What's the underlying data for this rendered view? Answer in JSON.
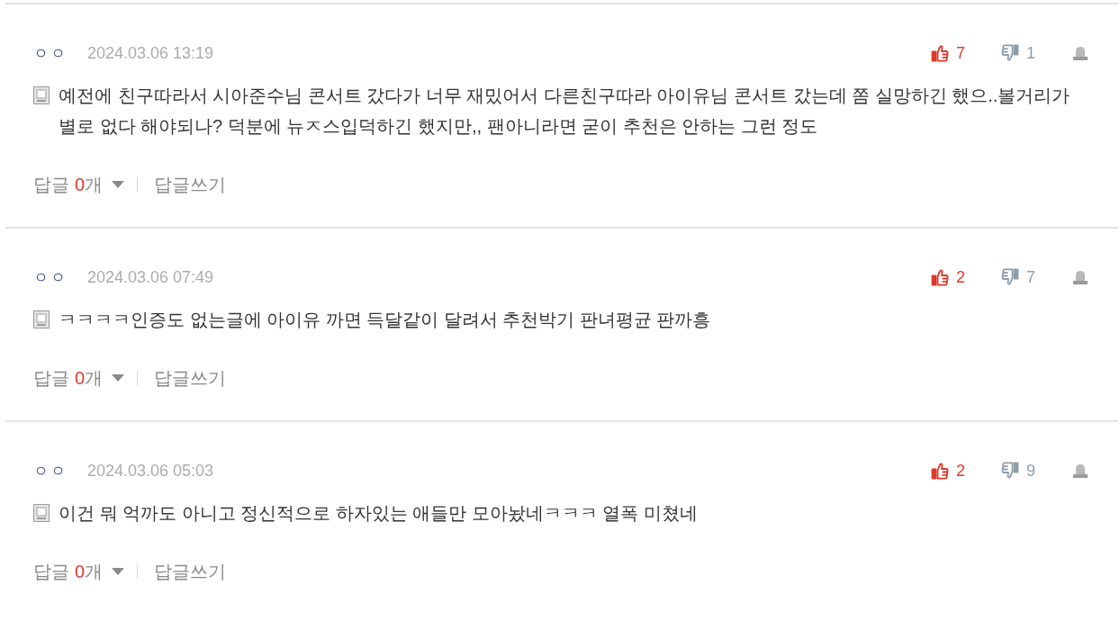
{
  "comments": [
    {
      "author": "ㅇㅇ",
      "date": "2024.03.06 13:19",
      "likes": "7",
      "dislikes": "1",
      "text": "예전에 친구따라서 시아준수님 콘서트 갔다가 너무 재밌어서 다른친구따라 아이유님 콘서트 갔는데 쫌 실망하긴 했으..볼거리가 별로 없다 해야되나? 덕분에 뉴ㅈ스입덕하긴 했지만,, 팬아니라면 굳이 추천은 안하는 그런 정도",
      "reply_label": "답글",
      "reply_count": "0",
      "reply_unit": "개",
      "write_reply": "답글쓰기"
    },
    {
      "author": "ㅇㅇ",
      "date": "2024.03.06 07:49",
      "likes": "2",
      "dislikes": "7",
      "text": "ㅋㅋㅋㅋ인증도 없는글에 아이유 까면 득달같이 달려서 추천박기 판녀평균 판까흥",
      "reply_label": "답글",
      "reply_count": "0",
      "reply_unit": "개",
      "write_reply": "답글쓰기"
    },
    {
      "author": "ㅇㅇ",
      "date": "2024.03.06 05:03",
      "likes": "2",
      "dislikes": "9",
      "text": "이건 뭐 억까도 아니고 정신적으로 하자있는 애들만 모아놨네ㅋㅋㅋ 열폭 미쳤네",
      "reply_label": "답글",
      "reply_count": "0",
      "reply_unit": "개",
      "write_reply": "답글쓰기"
    }
  ]
}
